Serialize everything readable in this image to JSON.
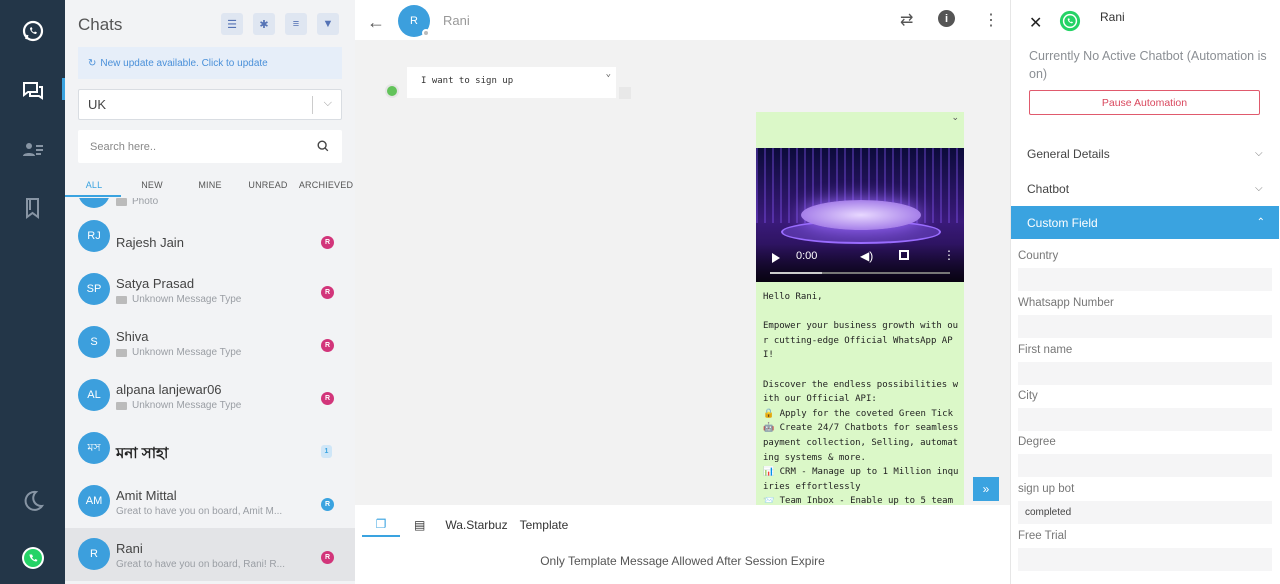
{
  "colors": {
    "accent": "#3aa3e0",
    "rail": "#233648",
    "outgoing_bubble": "#dbf8c8",
    "danger": "#d9475d"
  },
  "sidebar_title": "Chats",
  "update_banner": "New update available. Click to update",
  "country_select": "UK",
  "search_placeholder": "Search here..",
  "filter_tabs": [
    "ALL",
    "NEW",
    "MINE",
    "UNREAD",
    "ARCHIEVED"
  ],
  "conversations": [
    {
      "initials": "",
      "name": "",
      "preview": "Photo",
      "badge": "",
      "badge_color": ""
    },
    {
      "initials": "RJ",
      "name": "Rajesh Jain",
      "preview": "",
      "badge": "R",
      "badge_color": "#d2357a"
    },
    {
      "initials": "SP",
      "name": "Satya Prasad",
      "preview": "Unknown Message Type",
      "badge": "R",
      "badge_color": "#d2357a"
    },
    {
      "initials": "S",
      "name": "Shiva",
      "preview": "Unknown Message Type",
      "badge": "R",
      "badge_color": "#d2357a"
    },
    {
      "initials": "AL",
      "name": "alpana lanjewar06",
      "preview": "Unknown Message Type",
      "badge": "R",
      "badge_color": "#d2357a"
    },
    {
      "initials": "মস",
      "name": "মনা সাহা",
      "preview": "",
      "badge": "1",
      "badge_color": "#cfe6f7",
      "bold": true
    },
    {
      "initials": "AM",
      "name": "Amit Mittal",
      "preview": "Great to have you on board, Amit M...",
      "badge": "R",
      "badge_color": "#3aa3e0"
    },
    {
      "initials": "R",
      "name": "Rani",
      "preview": "Great to have you on board, Rani! R...",
      "badge": "R",
      "badge_color": "#d2357a",
      "active": true
    }
  ],
  "chat_header": {
    "initials": "R",
    "name": "Rani"
  },
  "messages": {
    "incoming": "I want to sign up",
    "video_time": "0:00",
    "outgoing_text": "Hello Rani,\n\nEmpower your business growth with our cutting-edge Official WhatsApp API!\n\nDiscover the endless possibilities with our Official API:\n🔒 Apply for the coveted Green Tick\n🤖 Create 24/7 Chatbots for seamless payment collection, Selling, automating systems & more.\n📊 CRM - Manage up to 1 Million inquiries effortlessly\n📨 Team Inbox - Enable up to 5 team"
  },
  "composer": {
    "tabs": [
      "",
      "",
      "Wa.Starbuz",
      "Template"
    ],
    "notice": "Only Template Message Allowed After Session Expire"
  },
  "details": {
    "contact_name": "Rani",
    "chatbot_status": "Currently No Active Chatbot (Automation is on)",
    "pause_button": "Pause Automation",
    "sections": [
      "General Details",
      "Chatbot",
      "Custom Field"
    ],
    "fields": [
      {
        "label": "Country",
        "value": ""
      },
      {
        "label": "Whatsapp Number",
        "value": ""
      },
      {
        "label": "First name",
        "value": ""
      },
      {
        "label": "City",
        "value": ""
      },
      {
        "label": "Degree",
        "value": ""
      },
      {
        "label": "sign up bot",
        "value": "completed"
      },
      {
        "label": "Free Trial",
        "value": ""
      }
    ]
  },
  "icons": [
    "whatsapp-icon",
    "chat-icon",
    "contacts-icon",
    "bookmark-icon",
    "moon-icon",
    "back-arrow-icon",
    "swap-icon",
    "info-icon",
    "more-icon",
    "close-icon",
    "chevron-down-icon",
    "chevron-up-icon",
    "search-icon",
    "camera-icon",
    "scroll-down-icon"
  ]
}
